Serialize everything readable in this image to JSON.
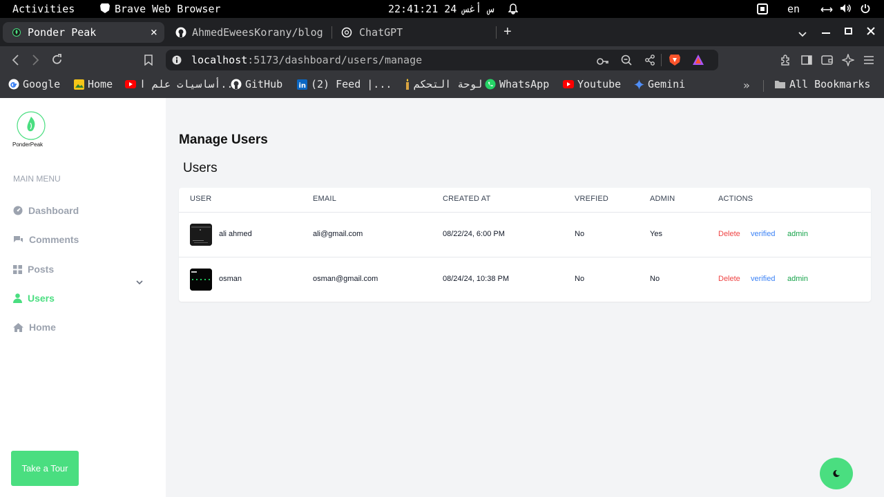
{
  "system_bar": {
    "activities": "Activities",
    "app_name": "Brave Web Browser",
    "clock": "22:41:21 24 س أغس",
    "lang": "en"
  },
  "tabs": [
    {
      "label": "Ponder Peak",
      "close": "×"
    },
    {
      "label": "AhmedEweesKorany/blog"
    },
    {
      "label": "ChatGPT"
    }
  ],
  "new_tab": "+",
  "url": {
    "host": "localhost",
    "path": ":5173/dashboard/users/manage"
  },
  "bookmarks": [
    {
      "label": "Google"
    },
    {
      "label": "Home"
    },
    {
      "label": "أساسيات علم ا..."
    },
    {
      "label": "GitHub"
    },
    {
      "label": "(2) Feed |..."
    },
    {
      "label": "لوحة التحكم"
    },
    {
      "label": "WhatsApp"
    },
    {
      "label": "Youtube"
    },
    {
      "label": "Gemini"
    }
  ],
  "all_bookmarks": "All Bookmarks",
  "logo": {
    "text": "PonderPeak",
    "colors": {
      "brand": "#4ade80"
    }
  },
  "sidebar": {
    "section_title": "MAIN MENU",
    "items": [
      {
        "label": "Dashboard",
        "icon": "dashboard-icon"
      },
      {
        "label": "Comments",
        "icon": "comments-icon"
      },
      {
        "label": "Posts",
        "icon": "posts-icon"
      },
      {
        "label": "Users",
        "icon": "users-icon",
        "active": true
      },
      {
        "label": "Home",
        "icon": "home-icon"
      }
    ],
    "tour_button": "Take a Tour"
  },
  "page": {
    "title": "Manage Users",
    "subtitle": "Users"
  },
  "table": {
    "headers": [
      "USER",
      "EMAIL",
      "CREATED AT",
      "VREFIED",
      "ADMIN",
      "ACTIONS"
    ],
    "rows": [
      {
        "name": "ali ahmed",
        "email": "ali@gmail.com",
        "created": "08/22/24, 6:00 PM",
        "verified": "No",
        "admin": "Yes",
        "actions": [
          "Delete",
          "verified",
          "admin"
        ]
      },
      {
        "name": "osman",
        "email": "osman@gmail.com",
        "created": "08/24/24, 10:38 PM",
        "verified": "No",
        "admin": "No",
        "actions": [
          "Delete",
          "verified",
          "admin"
        ]
      }
    ]
  },
  "colors": {
    "delete": "#ef4444",
    "verified": "#3b82f6",
    "admin": "#16a34a",
    "accent": "#4ade80"
  }
}
